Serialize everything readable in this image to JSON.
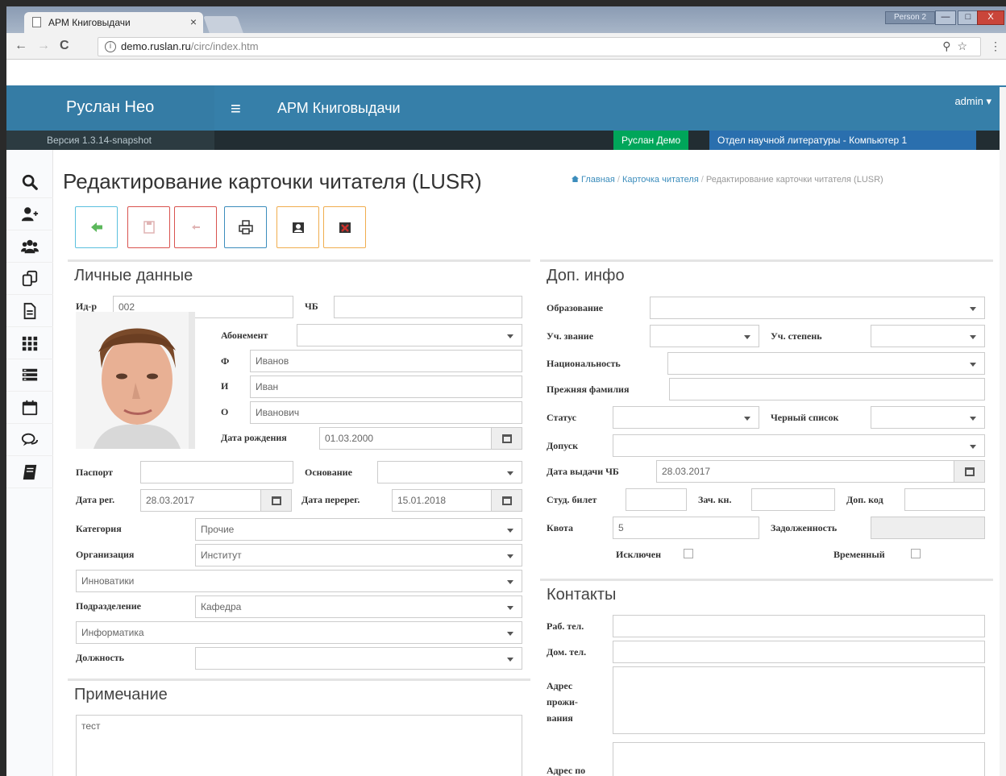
{
  "browser": {
    "tab_title": "АРМ Книговыдачи",
    "tab_close": "×",
    "url_host": "demo.ruslan.ru",
    "url_path": "/circ/index.htm",
    "user_chip": "Person 2",
    "nav_back": "←",
    "nav_forward": "→",
    "nav_reload": "C",
    "info_glyph": "i",
    "omnibox_icons": "⚲☆",
    "menu_glyph": "⋮",
    "win_min": "—",
    "win_max": "□",
    "win_close": "X"
  },
  "header": {
    "brand": "Руслан Нео",
    "hamburger": "≡",
    "app_title": "АРМ Книговыдачи",
    "admin": "admin ▾"
  },
  "status": {
    "version": "Версия 1.3.14-snapshot",
    "user": "Руслан Демо",
    "department": "Отдел научной литературы - Компьютер 1"
  },
  "sidebar": {
    "items": [
      {
        "icon": "search-icon"
      },
      {
        "icon": "add-user-icon"
      },
      {
        "icon": "users-icon"
      },
      {
        "icon": "copy-icon"
      },
      {
        "icon": "document-icon"
      },
      {
        "icon": "grid-icon"
      },
      {
        "icon": "list-icon"
      },
      {
        "icon": "calendar-icon"
      },
      {
        "icon": "chat-icon"
      },
      {
        "icon": "book-icon"
      }
    ]
  },
  "page": {
    "title": "Редактирование карточки читателя (LUSR)",
    "breadcrumb": [
      "Главная",
      "Карточка читателя",
      "Редактирование карточки читателя (LUSR)"
    ],
    "breadcrumb_sep": "/"
  },
  "toolbar": [
    {
      "name": "back-button",
      "icon": "arrow-left-icon",
      "color": "#5cb85c",
      "border": "#5bc0de"
    },
    {
      "name": "save-button",
      "icon": "save-icon",
      "color": "#d9a8a8",
      "border": "#d9534f"
    },
    {
      "name": "undo-button",
      "icon": "undo-icon",
      "color": "#d9a8a8",
      "border": "#d9534f"
    },
    {
      "name": "print-button",
      "icon": "print-icon",
      "color": "#333333",
      "border": "#3c8dbc"
    },
    {
      "name": "card-button",
      "icon": "user-card-icon",
      "color": "#333333",
      "border": "#f0ad4e"
    },
    {
      "name": "delete-card-button",
      "icon": "delete-card-icon",
      "color": "#c9302c",
      "border": "#f0ad4e"
    }
  ],
  "personal": {
    "title": "Личные данные",
    "id_label": "Ид-р",
    "id_value": "002",
    "chb_label": "ЧБ",
    "chb_value": "",
    "abonement_label": "Абонемент",
    "abonement_value": "",
    "f_label": "Ф",
    "f_value": "Иванов",
    "i_label": "И",
    "i_value": "Иван",
    "o_label": "О",
    "o_value": "Иванович",
    "birth_label": "Дата рождения",
    "birth_value": "01.03.2000",
    "passport_label": "Паспорт",
    "passport_value": "",
    "basis_label": "Основание",
    "basis_value": "",
    "reg_label": "Дата рег.",
    "reg_value": "28.03.2017",
    "rereg_label": "Дата перерег.",
    "rereg_value": "15.01.2018",
    "category_label": "Категория",
    "category_value": "Прочие",
    "org_label": "Организация",
    "org_value": "Институт",
    "org_sub_value": "Инноватики",
    "division_label": "Подразделение",
    "division_value": "Кафедра",
    "division_sub_value": "Информатика",
    "position_label": "Должность",
    "position_value": ""
  },
  "note": {
    "title": "Примечание",
    "value": "тест"
  },
  "extra": {
    "title": "Доп. инфо",
    "education_label": "Образование",
    "education_value": "",
    "rank_label": "Уч. звание",
    "rank_value": "",
    "degree_label": "Уч. степень",
    "degree_value": "",
    "nationality_label": "Национальность",
    "nationality_value": "",
    "maiden_label": "Прежняя фамилия",
    "maiden_value": "",
    "status_label": "Статус",
    "status_value": "",
    "blacklist_label": "Черный список",
    "blacklist_value": "",
    "access_label": "Допуск",
    "access_value": "",
    "issue_label": "Дата выдачи ЧБ",
    "issue_value": "28.03.2017",
    "student_label": "Студ. билет",
    "student_value": "",
    "record_label": "Зач. кн.",
    "record_value": "",
    "extra_code_label": "Доп. код",
    "extra_code_value": "",
    "quota_label": "Квота",
    "quota_value": "5",
    "debt_label": "Задолженность",
    "debt_value": "",
    "excluded_label": "Исключен",
    "temporary_label": "Временный"
  },
  "contacts": {
    "title": "Контакты",
    "work_phone_label": "Раб. тел.",
    "work_phone_value": "",
    "home_phone_label": "Дом. тел.",
    "home_phone_value": "",
    "address_label": "Адрес прожи-вания",
    "address_value": "",
    "address2_label": "Адрес по"
  },
  "colors": {
    "header_blue": "#367fa9",
    "status_green": "#00a65a",
    "status_blue": "#2a6fae",
    "dark_bar": "#222d32"
  }
}
